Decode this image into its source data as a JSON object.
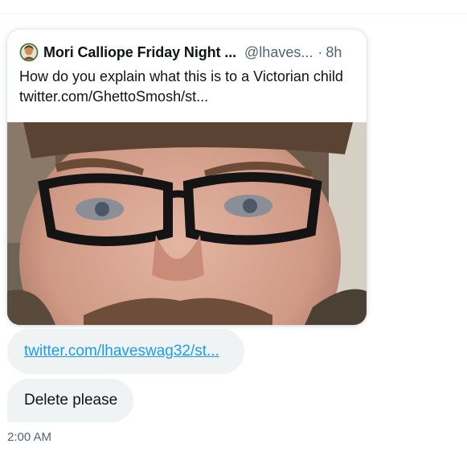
{
  "quoted_tweet": {
    "author_name": "Mori Calliope Friday Night ...",
    "handle": "@lhaves...",
    "separator": "·",
    "time_ago": "8h",
    "text": "How do you explain what this is to a Victorian child twitter.com/GhettoSmosh/st..."
  },
  "link_message": {
    "url_text": "twitter.com/lhaveswag32/st..."
  },
  "text_message": {
    "text": "Delete please"
  },
  "message_timestamp": "2:00 AM",
  "colors": {
    "link": "#1d9bf0",
    "bubble": "#eff3f4",
    "secondary_text": "#536471",
    "primary_text": "#0f1419"
  }
}
